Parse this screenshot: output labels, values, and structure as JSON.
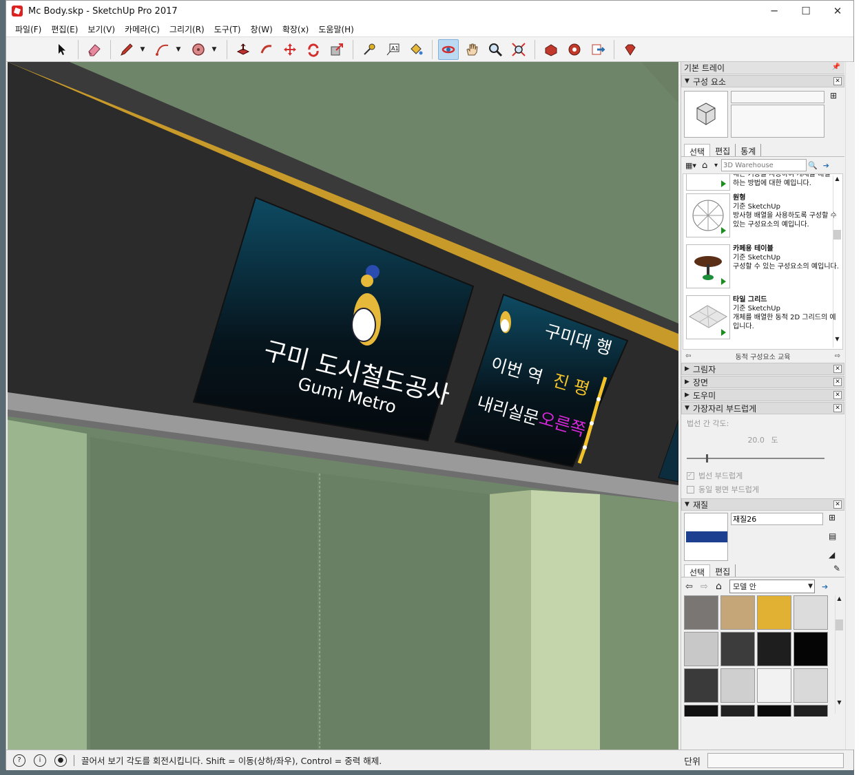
{
  "window": {
    "title": "Mc Body.skp - SketchUp Pro 2017",
    "controls": [
      "─",
      "☐",
      "✕"
    ]
  },
  "menu": [
    "파일(F)",
    "편집(E)",
    "보기(V)",
    "카메라(C)",
    "그리기(R)",
    "도구(T)",
    "창(W)",
    "확장(x)",
    "도움말(H)"
  ],
  "toolbar": {
    "tools": [
      "select-tool",
      "eraser-tool",
      "pencil-tool",
      "arc-tool",
      "shapes-tool",
      "push-pull-tool",
      "follow-me-tool",
      "move-tool",
      "rotate-tool",
      "scale-tool",
      "tape-tool",
      "text-tool",
      "paint-tool",
      "orbit-tool",
      "pan-tool",
      "zoom-tool",
      "zoom-extents-tool",
      "warehouse-tool",
      "extension-tool",
      "share-tool",
      "ruby-tool"
    ],
    "active": "orbit-tool"
  },
  "viewport": {
    "sign_main_title": "구미 도시철도공사",
    "sign_main_subtitle": "Gumi Metro",
    "sign2_dest": "구미대 행",
    "sign2_this_station": "이번 역",
    "sign2_station": "진 평",
    "sign2_exit": "내리실문",
    "sign2_side": "오른쪽",
    "colors": {
      "wall": "#6f8569",
      "beam": "#2a2a2a",
      "stripe": "#c79a2a",
      "screen": "#0b3a4e",
      "yellow_text": "#f2c22a",
      "magenta_text": "#d628d8"
    }
  },
  "tray": {
    "title": "기본 트레이",
    "components": {
      "header": "구성 요소",
      "tabs": [
        "선택",
        "편집",
        "통계"
      ],
      "search_placeholder": "3D Warehouse",
      "partial_text_1": "해는 기능을 사용하여 개체를 배열",
      "partial_text_2": "하는 방법에 대한 예입니다.",
      "items": [
        {
          "name": "원형",
          "source": "기준 SketchUp",
          "desc": "방사형 배열을 사용하도록 구성할 수 있는 구성요소의 예입니다."
        },
        {
          "name": "카페용 테이블",
          "source": "기준 SketchUp",
          "desc": "구성할 수 있는 구성요소의 예입니다."
        },
        {
          "name": "타일 그리드",
          "source": "기준 SketchUp",
          "desc": "개체를 배열한 동적 2D 그리드의 예입니다."
        }
      ],
      "footer": "동적 구성요소 교육"
    },
    "collapsed_panels": [
      "그림자",
      "장면",
      "도우미"
    ],
    "soften": {
      "header": "가장자리 부드럽게",
      "angle_label": "법선 간 각도:",
      "angle_value": "20.0",
      "angle_unit": "도",
      "check1": "법선 부드럽게",
      "check2": "동일 평면 부드럽게"
    },
    "materials": {
      "header": "재질",
      "name": "재질26",
      "tabs": [
        "선택",
        "편집"
      ],
      "dropdown": "모델 안",
      "swatches": [
        "#7a7673",
        "#c4a679",
        "#e1b133",
        "#dcdcdc",
        "#c8c8c8",
        "#3c3c3c",
        "#1e1e1e",
        "#050505",
        "#3a3a3a",
        "#cfcfcf",
        "#f2f2f2",
        "#d9d9d9",
        "#111111",
        "#222222",
        "#0a0a0a",
        "#202020"
      ]
    },
    "scrollbar_up": "▲",
    "scrollbar_down": "▼"
  },
  "status": {
    "message": "끌어서 보기 각도를 회전시킵니다. Shift = 이동(상하/좌우), Control = 중력 해제.",
    "measure_label": "단위",
    "measure_value": ""
  }
}
